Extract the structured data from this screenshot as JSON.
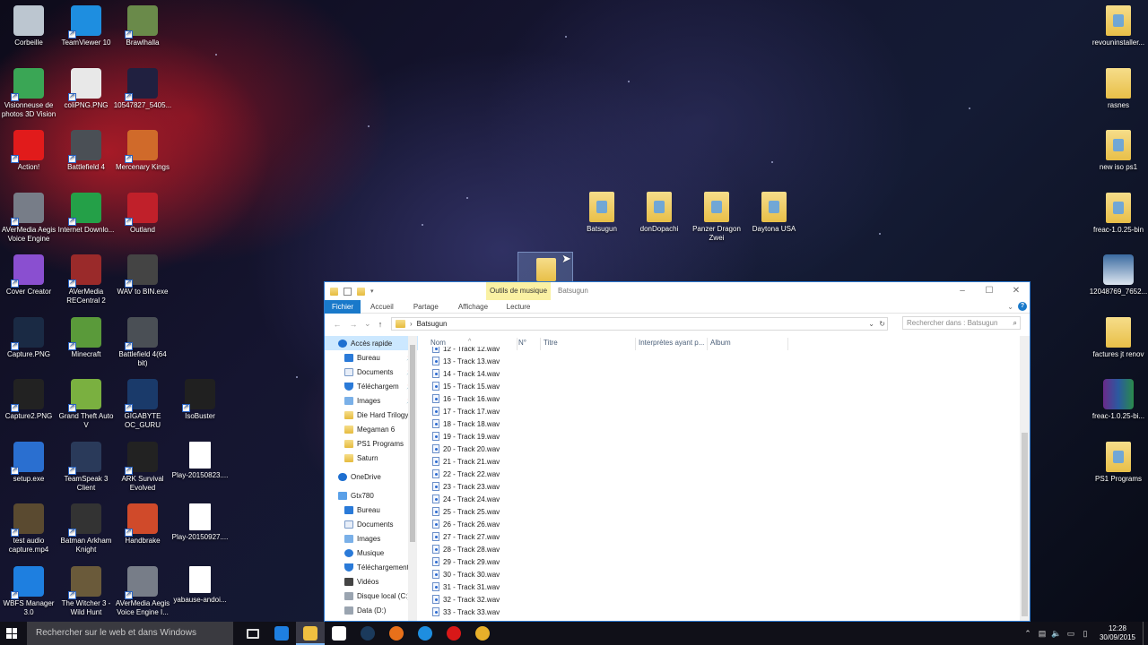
{
  "desktop": {
    "icons_col1": [
      {
        "label": "Corbeille",
        "color": "#bcc6d0",
        "type": "bin"
      },
      {
        "label": "Visionneuse de photos 3D Vision",
        "color": "#3aa655",
        "type": "app"
      },
      {
        "label": "Action!",
        "color": "#e11b1b",
        "type": "app"
      },
      {
        "label": "AVerMedia Aegis Voice Engine",
        "color": "#777d88",
        "type": "app"
      },
      {
        "label": "Cover Creator",
        "color": "#8a4fd0",
        "type": "app"
      },
      {
        "label": "Capture.PNG",
        "color": "#1a2a44",
        "type": "app"
      },
      {
        "label": "Capture2.PNG",
        "color": "#222",
        "type": "app"
      },
      {
        "label": "setup.exe",
        "color": "#2a6fd0",
        "type": "app"
      },
      {
        "label": "test audio capture.mp4",
        "color": "#5a4a30",
        "type": "app"
      },
      {
        "label": "WBFS Manager 3.0",
        "color": "#1e7fe0",
        "type": "app"
      }
    ],
    "icons_col2": [
      {
        "label": "TeamViewer 10",
        "color": "#1e8ee0",
        "type": "app"
      },
      {
        "label": "coliPNG.PNG",
        "color": "#e8e8e8",
        "type": "app"
      },
      {
        "label": "Battlefield 4",
        "color": "#4a4f55",
        "type": "app"
      },
      {
        "label": "Internet Downlo...",
        "color": "#24a048",
        "type": "app"
      },
      {
        "label": "AVerMedia RECentral 2",
        "color": "#9a2a2a",
        "type": "app"
      },
      {
        "label": "Minecraft",
        "color": "#5a9a3a",
        "type": "app"
      },
      {
        "label": "Grand Theft Auto V",
        "color": "#7ab040",
        "type": "app"
      },
      {
        "label": "TeamSpeak 3 Client",
        "color": "#2a3a5a",
        "type": "app"
      },
      {
        "label": "Batman Arkham Knight",
        "color": "#333",
        "type": "app"
      },
      {
        "label": "The Witcher 3 - Wild Hunt",
        "color": "#6a5a3a",
        "type": "app"
      }
    ],
    "icons_col3": [
      {
        "label": "Brawlhalla",
        "color": "#6a8a4a",
        "type": "app"
      },
      {
        "label": "10547827_5405...",
        "color": "#202040",
        "type": "app"
      },
      {
        "label": "Mercenary Kings",
        "color": "#d06a2a",
        "type": "app"
      },
      {
        "label": "Outland",
        "color": "#c0202a",
        "type": "app"
      },
      {
        "label": "WAV to BIN.exe",
        "color": "#444",
        "type": "app"
      },
      {
        "label": "Battlefield 4(64 bit)",
        "color": "#4a4f55",
        "type": "app"
      },
      {
        "label": "GIGABYTE OC_GURU",
        "color": "#1a3a6a",
        "type": "app"
      },
      {
        "label": "ARK Survival Evolved",
        "color": "#222",
        "type": "app"
      },
      {
        "label": "Handbrake",
        "color": "#d04a2a",
        "type": "app"
      },
      {
        "label": "AVerMedia Aegis Voice Engine I...",
        "color": "#777d88",
        "type": "app"
      }
    ],
    "icons_col4": [
      {
        "label": "IsoBuster",
        "color": "#202020",
        "type": "app",
        "row": 6
      },
      {
        "label": "Play-20150823....",
        "color": "#ffffff",
        "type": "file",
        "row": 7
      },
      {
        "label": "Play-20150927....",
        "color": "#ffffff",
        "type": "file",
        "row": 8
      },
      {
        "label": "yabause-andoi...",
        "color": "#ffffff",
        "type": "file",
        "row": 9
      }
    ],
    "icons_right": [
      {
        "label": "revouninstaller...",
        "type": "folder"
      },
      {
        "label": "rasnes",
        "type": "folder-plain"
      },
      {
        "label": "new iso ps1",
        "type": "folder"
      },
      {
        "label": "freac-1.0.25-bin",
        "type": "folder"
      },
      {
        "label": "12048769_7652...",
        "type": "image"
      },
      {
        "label": "factures jt renov",
        "type": "folder-plain"
      },
      {
        "label": "freac-1.0.25-bi...",
        "type": "archive"
      },
      {
        "label": "PS1 Programs",
        "type": "folder"
      }
    ],
    "icons_center": [
      {
        "label": "Batsugun"
      },
      {
        "label": "donDopachi"
      },
      {
        "label": "Panzer Dragon Zwei"
      },
      {
        "label": "Daytona USA"
      }
    ]
  },
  "explorer": {
    "title": "Batsugun",
    "context_tab": "Outils de musique",
    "context_subtab": "Lecture",
    "ribbon_tabs": [
      "Fichier",
      "Accueil",
      "Partage",
      "Affichage"
    ],
    "address": "Batsugun",
    "search_placeholder": "Rechercher dans : Batsugun",
    "columns": [
      "Nom",
      "N°",
      "Titre",
      "Interprètes ayant p...",
      "Album"
    ],
    "nav_quick": [
      {
        "label": "Accès rapide",
        "kind": "star",
        "top": true,
        "selected": true
      },
      {
        "label": "Bureau",
        "kind": "blue",
        "pin": true
      },
      {
        "label": "Documents",
        "kind": "doc",
        "pin": true
      },
      {
        "label": "Téléchargem",
        "kind": "down",
        "pin": true
      },
      {
        "label": "Images",
        "kind": "img",
        "pin": true
      },
      {
        "label": "Die Hard Trilogy",
        "kind": "folder"
      },
      {
        "label": "Megaman 6",
        "kind": "folder"
      },
      {
        "label": "PS1 Programs",
        "kind": "folder"
      },
      {
        "label": "Saturn",
        "kind": "folder"
      }
    ],
    "nav_onedrive": "OneDrive",
    "nav_pc": [
      {
        "label": "Gtx780",
        "kind": "pc",
        "top": true
      },
      {
        "label": "Bureau",
        "kind": "blue"
      },
      {
        "label": "Documents",
        "kind": "doc"
      },
      {
        "label": "Images",
        "kind": "img"
      },
      {
        "label": "Musique",
        "kind": "music"
      },
      {
        "label": "Téléchargement",
        "kind": "down"
      },
      {
        "label": "Vidéos",
        "kind": "vid"
      },
      {
        "label": "Disque local (C:)",
        "kind": "disk"
      },
      {
        "label": "Data (D:)",
        "kind": "disk"
      }
    ],
    "files": [
      "12 - Track 12.wav",
      "13 - Track 13.wav",
      "14 - Track 14.wav",
      "15 - Track 15.wav",
      "16 - Track 16.wav",
      "17 - Track 17.wav",
      "18 - Track 18.wav",
      "19 - Track 19.wav",
      "20 - Track 20.wav",
      "21 - Track 21.wav",
      "22 - Track 22.wav",
      "23 - Track 23.wav",
      "24 - Track 24.wav",
      "25 - Track 25.wav",
      "26 - Track 26.wav",
      "27 - Track 27.wav",
      "28 - Track 28.wav",
      "29 - Track 29.wav",
      "30 - Track 30.wav",
      "31 - Track 31.wav",
      "32 - Track 32.wav",
      "33 - Track 33.wav"
    ]
  },
  "taskbar": {
    "search_placeholder": "Rechercher sur le web et dans Windows",
    "apps": [
      {
        "name": "task-view",
        "color": "#dddddd"
      },
      {
        "name": "edge",
        "color": "#1e7fe0"
      },
      {
        "name": "file-explorer",
        "color": "#f0c040",
        "active": true
      },
      {
        "name": "store",
        "color": "#ffffff"
      },
      {
        "name": "steam",
        "color": "#1b3a5c"
      },
      {
        "name": "firefox",
        "color": "#e8701a"
      },
      {
        "name": "teamviewer",
        "color": "#1e8ee0"
      },
      {
        "name": "action",
        "color": "#d81818"
      },
      {
        "name": "chrome",
        "color": "#e8b02a"
      }
    ],
    "time": "12:28",
    "date": "30/09/2015"
  }
}
